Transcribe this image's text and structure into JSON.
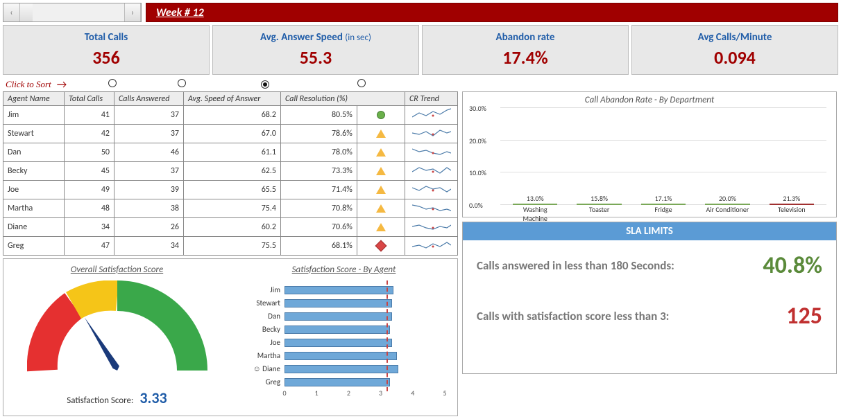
{
  "header": {
    "week_label": "Week # 12"
  },
  "kpis": {
    "total_calls": {
      "title": "Total Calls",
      "value": "356"
    },
    "answer_speed": {
      "title": "Avg. Answer Speed",
      "sub": "(in sec)",
      "value": "55.3"
    },
    "abandon": {
      "title": "Abandon rate",
      "value": "17.4%"
    },
    "cpm": {
      "title": "Avg Calls/Minute",
      "value": "0.094"
    }
  },
  "sort_hint": "Click to Sort",
  "table": {
    "headers": [
      "Agent Name",
      "Total Calls",
      "Calls Answered",
      "Avg. Speed of Answer",
      "Call Resolution (%)",
      "CR Trend"
    ],
    "selected_sort": 4,
    "rows": [
      {
        "name": "Jim",
        "total": 41,
        "ans": 37,
        "speed": "68.2",
        "cr": "80.5%",
        "ind": "g"
      },
      {
        "name": "Stewart",
        "total": 42,
        "ans": 37,
        "speed": "67.0",
        "cr": "78.6%",
        "ind": "y"
      },
      {
        "name": "Dan",
        "total": 50,
        "ans": 46,
        "speed": "61.1",
        "cr": "78.0%",
        "ind": "y"
      },
      {
        "name": "Becky",
        "total": 45,
        "ans": 37,
        "speed": "62.5",
        "cr": "73.3%",
        "ind": "y"
      },
      {
        "name": "Joe",
        "total": 49,
        "ans": 39,
        "speed": "65.5",
        "cr": "71.4%",
        "ind": "y"
      },
      {
        "name": "Martha",
        "total": 48,
        "ans": 38,
        "speed": "75.4",
        "cr": "70.8%",
        "ind": "y"
      },
      {
        "name": "Diane",
        "total": 34,
        "ans": 26,
        "speed": "60.2",
        "cr": "70.6%",
        "ind": "y"
      },
      {
        "name": "Greg",
        "total": 47,
        "ans": 34,
        "speed": "75.5",
        "cr": "68.1%",
        "ind": "r"
      }
    ]
  },
  "gauge": {
    "title": "Overall Satisfaction Score",
    "label": "Satisfaction Score:",
    "value": "3.33"
  },
  "sat_by_agent": {
    "title": "Satisfaction Score - By Agent",
    "max": 5,
    "target": 3.4,
    "rows": [
      {
        "name": "Jim",
        "v": 3.4
      },
      {
        "name": "Stewart",
        "v": 3.35
      },
      {
        "name": "Dan",
        "v": 3.35
      },
      {
        "name": "Becky",
        "v": 3.3
      },
      {
        "name": "Joe",
        "v": 3.35
      },
      {
        "name": "Martha",
        "v": 3.5
      },
      {
        "name": "Diane",
        "v": 3.55,
        "smile": true
      },
      {
        "name": "Greg",
        "v": 3.3
      }
    ],
    "ticks": [
      0,
      1,
      2,
      3,
      4,
      5
    ]
  },
  "sla": {
    "title": "SLA LIMITS",
    "r1": {
      "text": "Calls answered in less than 180 Seconds:",
      "value": "40.8%",
      "cls": "g"
    },
    "r2": {
      "text": "Calls with satisfaction score less than 3:",
      "value": "125",
      "cls": "r"
    }
  },
  "chart_data": {
    "type": "bar",
    "title": "Call Abandon Rate - By Department",
    "categories": [
      "Washing Machine",
      "Toaster",
      "Fridge",
      "Air Conditioner",
      "Television"
    ],
    "values": [
      13.0,
      15.8,
      17.1,
      20.0,
      21.3
    ],
    "highlight_index": 4,
    "ylim": [
      0,
      30
    ],
    "yticks": [
      0,
      10,
      20,
      30
    ],
    "ylabel_fmt": "%",
    "xlabel": "",
    "ylabel": ""
  }
}
